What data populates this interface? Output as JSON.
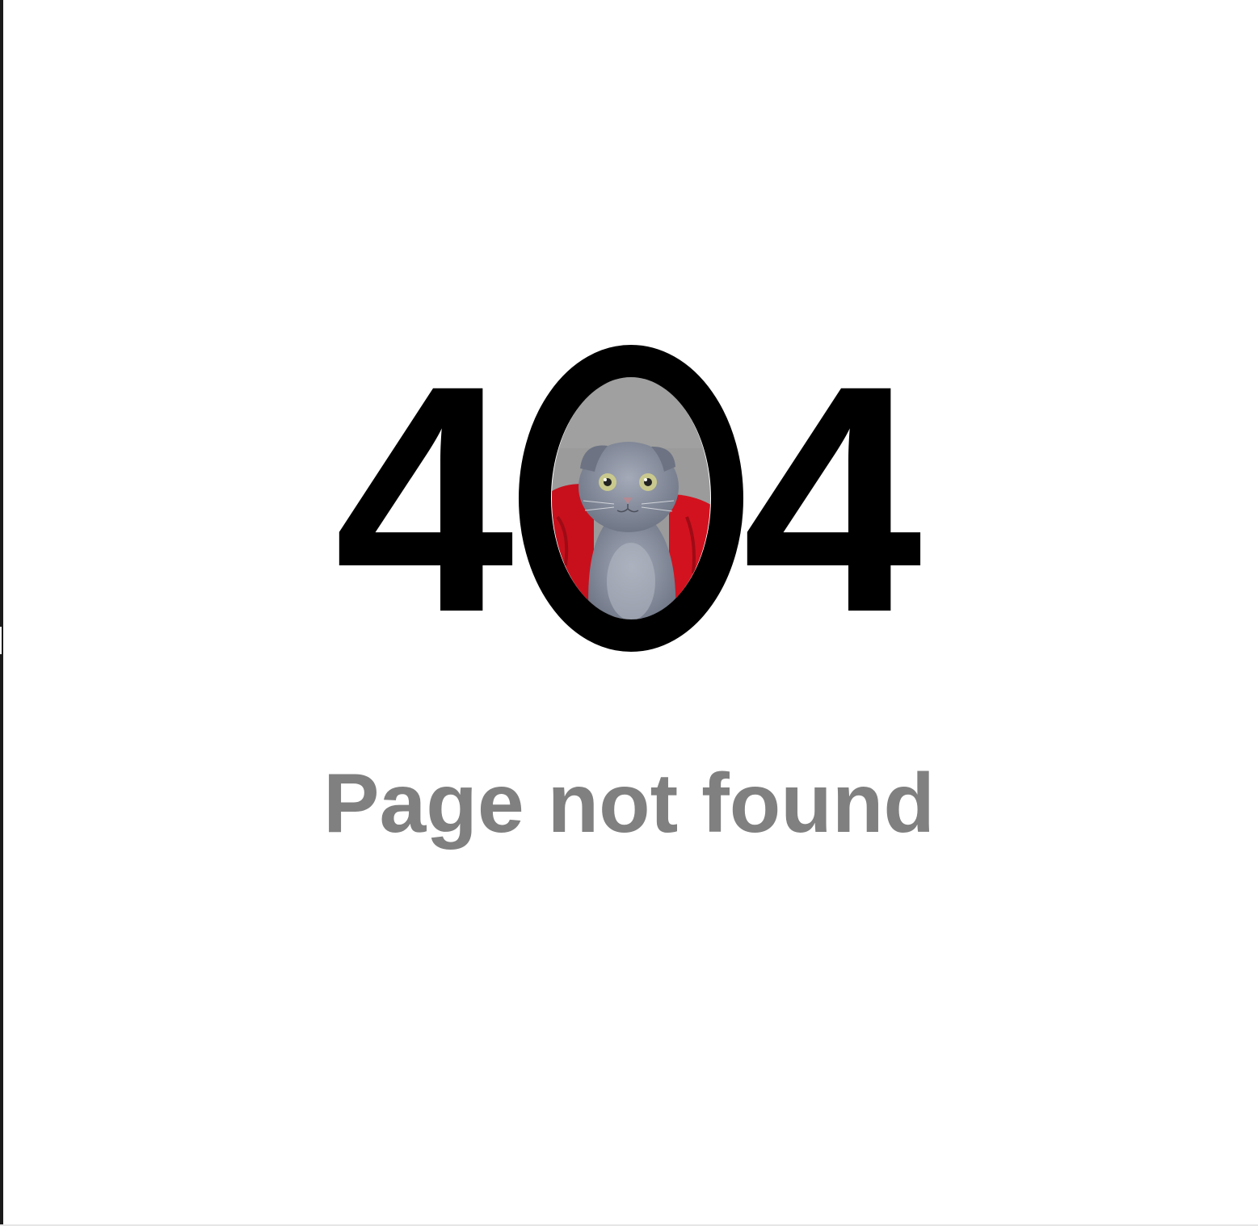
{
  "error": {
    "code_left": "4",
    "code_right": "4",
    "message": "Page not found"
  },
  "illustration": {
    "subject": "grey-kitten",
    "backdrop": "red-cushion"
  },
  "colors": {
    "background": "#ffffff",
    "digits": "#000000",
    "message": "#808080",
    "wall": "#9a9a9a",
    "cushion": "#d3121f",
    "cat_fur": "#7d8495",
    "cat_fur_light": "#a4aab8",
    "cat_eye": "#c9c98e"
  }
}
